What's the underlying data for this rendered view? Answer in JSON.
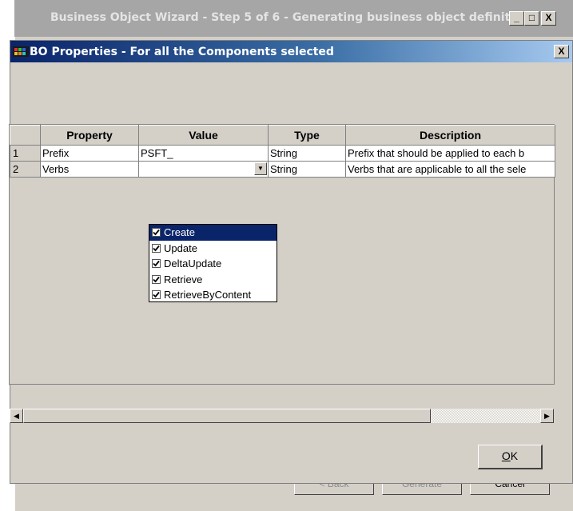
{
  "outer_window": {
    "title": "Business Object Wizard - Step 5 of 6 - Generating business object definiti...",
    "controls": {
      "minimize": "_",
      "maximize": "□",
      "close": "X"
    },
    "buttons": {
      "back": "< Back",
      "generate": "Generate",
      "cancel": "Cancel"
    }
  },
  "dialog": {
    "title": "BO Properties - For all the Components selected",
    "close": "X",
    "table": {
      "columns": [
        "",
        "Property",
        "Value",
        "Type",
        "Description"
      ],
      "rows": [
        {
          "num": "1",
          "property": "Prefix",
          "value": "PSFT_",
          "type": "String",
          "description": "Prefix that should be applied to each b"
        },
        {
          "num": "2",
          "property": "Verbs",
          "value": "",
          "type": "String",
          "description": "Verbs that are applicable to all the sele"
        }
      ]
    },
    "verbs_dropdown": {
      "items": [
        {
          "label": "Create",
          "checked": true,
          "selected": true
        },
        {
          "label": "Update",
          "checked": true,
          "selected": false
        },
        {
          "label": "DeltaUpdate",
          "checked": true,
          "selected": false
        },
        {
          "label": "Retrieve",
          "checked": true,
          "selected": false
        },
        {
          "label": "RetrieveByContent",
          "checked": true,
          "selected": false
        }
      ]
    },
    "ok_button": {
      "accel": "O",
      "rest": "K"
    }
  },
  "colors": {
    "title_bar_active": "#0a246a",
    "title_bar_inactive": "#a6a6a6",
    "face": "#d4d0c8"
  }
}
